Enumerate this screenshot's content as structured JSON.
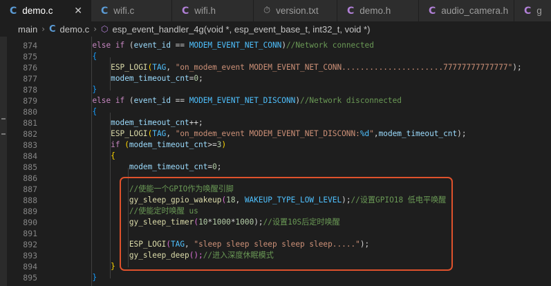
{
  "tabs": [
    {
      "icon": "C",
      "type": "c",
      "label": "demo.c",
      "active": true
    },
    {
      "icon": "C",
      "type": "c",
      "label": "wifi.c"
    },
    {
      "icon": "C",
      "type": "h",
      "label": "wifi.h"
    },
    {
      "icon": "⏱",
      "type": "clock",
      "label": "version.txt"
    },
    {
      "icon": "C",
      "type": "h",
      "label": "demo.h"
    },
    {
      "icon": "C",
      "type": "h",
      "label": "audio_camera.h"
    },
    {
      "icon": "C",
      "type": "h",
      "label": "g"
    }
  ],
  "close_glyph": "✕",
  "breadcrumb": {
    "root": "main",
    "file_icon": "C",
    "file": "demo.c",
    "symbol_icon": "⬡",
    "symbol": "esp_event_handler_4g(void *, esp_event_base_t, int32_t, void *)"
  },
  "line_numbers": [
    "874",
    "875",
    "876",
    "877",
    "878",
    "879",
    "880",
    "881",
    "882",
    "883",
    "884",
    "885",
    "886",
    "887",
    "888",
    "889",
    "890",
    "891",
    "892",
    "893",
    "894",
    "895"
  ],
  "code": {
    "l874": {
      "indent": "        ",
      "kw": "else if",
      "p1": " (",
      "var": "event_id",
      "op": " == ",
      "macro": "MODEM_EVENT_NET_CONN",
      "p2": ")",
      "cmt": "//Network connected"
    },
    "l875": {
      "indent": "        ",
      "brace": "{"
    },
    "l876": {
      "indent": "            ",
      "fn": "ESP_LOGI",
      "p1": "(",
      "macro": "TAG",
      "p2": ", ",
      "str": "\"on_modem_event MODEM_EVENT_NET_CONN......................77777777777777\"",
      "p3": ");"
    },
    "l877": {
      "indent": "            ",
      "var": "modem_timeout_cnt",
      "op": "=",
      "num": "0",
      "p1": ";"
    },
    "l878": {
      "indent": "        ",
      "brace": "}"
    },
    "l879": {
      "indent": "        ",
      "kw": "else if",
      "p1": " (",
      "var": "event_id",
      "op": " == ",
      "macro": "MODEM_EVENT_NET_DISCONN",
      "p2": ")",
      "cmt": "//Network disconnected"
    },
    "l880": {
      "indent": "        ",
      "brace": "{"
    },
    "l881": {
      "indent": "            ",
      "var": "modem_timeout_cnt",
      "op": "++;"
    },
    "l882": {
      "indent": "            ",
      "fn": "ESP_LOGI",
      "p1": "(",
      "macro": "TAG",
      "p2": ", ",
      "str": "\"on_modem_event MODEM_EVENT_NET_DISCONN:",
      "fmt": "%d",
      "str2": "\"",
      "p3": ",",
      "var": "modem_timeout_cnt",
      "p4": ");"
    },
    "l883": {
      "indent": "            ",
      "kw": "if",
      "p1": " (",
      "var": "modem_timeout_cnt",
      "op": ">=",
      "num": "3",
      "p2": ")"
    },
    "l884": {
      "indent": "            ",
      "brace": "{"
    },
    "l885": {
      "indent": "                ",
      "var": "modem_timeout_cnt",
      "op": "=",
      "num": "0",
      "p1": ";"
    },
    "l886": {
      "indent": "",
      "text": ""
    },
    "l887": {
      "indent": "                ",
      "cmt": "//使能一个GPIO作为唤醒引脚"
    },
    "l888": {
      "indent": "                ",
      "fn": "gy_sleep_gpio_wakeup",
      "p1": "(",
      "num": "18",
      "p2": ", ",
      "macro": "WAKEUP_TYPE_LOW_LEVEL",
      "p3": ");",
      "cmt": "//设置GPIO18 低电平唤醒"
    },
    "l889": {
      "indent": "                ",
      "cmt": "//使能定时唤醒 us"
    },
    "l890": {
      "indent": "                ",
      "fn": "gy_sleep_timer",
      "p1": "(",
      "num": "10",
      "op": "*",
      "num2": "1000",
      "op2": "*",
      "num3": "1000",
      "p2": ");",
      "cmt": "//设置10S后定时唤醒"
    },
    "l891": {
      "indent": "",
      "text": ""
    },
    "l892": {
      "indent": "                ",
      "fn": "ESP_LOGI",
      "p1": "(",
      "macro": "TAG",
      "p2": ", ",
      "str": "\"sleep sleep sleep sleep sleep.....\"",
      "p3": ");"
    },
    "l893": {
      "indent": "                ",
      "fn": "gy_sleep_deep",
      "p1": "();",
      "cmt": "//进入深度休眠模式"
    },
    "l894": {
      "indent": "            ",
      "brace": "}"
    },
    "l895": {
      "indent": "        ",
      "brace": "}"
    }
  },
  "colors": {
    "highlight_border": "#e0522c",
    "keyword": "#c586c0",
    "function": "#dcdcaa",
    "variable": "#9cdcfe",
    "macro": "#4fc1ff",
    "string": "#ce9178",
    "number": "#b5cea8",
    "comment": "#6a9955"
  }
}
